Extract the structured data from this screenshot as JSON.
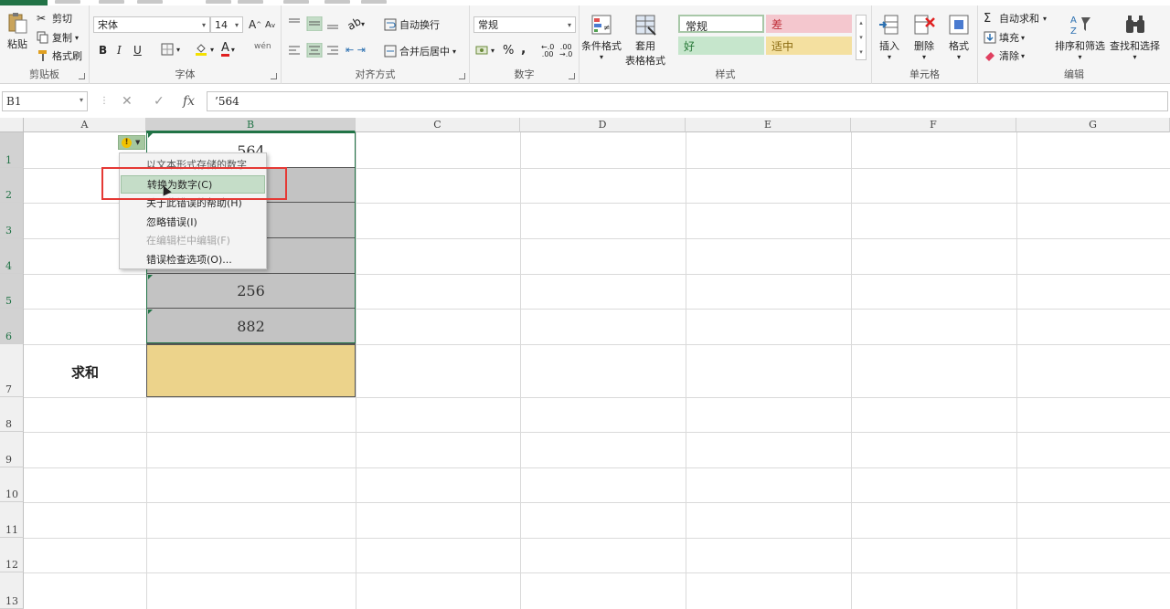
{
  "ribbon": {
    "clipboard": {
      "label": "剪贴板",
      "paste": "粘贴",
      "cut": "剪切",
      "copy": "复制",
      "format_painter": "格式刷"
    },
    "font": {
      "label": "字体",
      "name": "宋体",
      "size": "14",
      "bold": "B",
      "italic": "I",
      "underline": "U"
    },
    "alignment": {
      "label": "对齐方式",
      "wrap_text": "自动换行",
      "merge_center": "合并后居中"
    },
    "number": {
      "label": "数字",
      "format": "常规",
      "percent": "%",
      "comma": ","
    },
    "styles": {
      "label": "样式",
      "conditional_format": "条件格式",
      "table_format_line1": "套用",
      "table_format_line2": "表格格式",
      "normal": "常规",
      "bad": "差",
      "good": "好",
      "neutral": "适中",
      "colors": {
        "normal": "#ffffff",
        "bad": "#f4c7ce",
        "good": "#c6e6cc",
        "neutral": "#f4e0a0"
      }
    },
    "cells": {
      "label": "单元格",
      "insert": "插入",
      "delete": "删除",
      "format": "格式"
    },
    "editing": {
      "label": "编辑",
      "autosum": "自动求和",
      "fill": "填充",
      "clear": "清除",
      "sort_filter": "排序和筛选",
      "find_select": "查找和选择"
    }
  },
  "formula_bar": {
    "name_box": "B1",
    "cancel": "✕",
    "enter": "✓",
    "fx": "fx",
    "content": "’564"
  },
  "sheet": {
    "columns": [
      "A",
      "B",
      "C",
      "D",
      "E",
      "F",
      "G"
    ],
    "rows": [
      "1",
      "2",
      "3",
      "4",
      "5",
      "6",
      "7",
      "8",
      "9",
      "10",
      "11",
      "12",
      "13"
    ],
    "cells": {
      "B1": "564",
      "B5": "256",
      "B6": "882",
      "A7": "求和"
    }
  },
  "error_menu": {
    "title": "以文本形式存储的数字",
    "items": [
      {
        "label": "转换为数字(C)",
        "state": "hover"
      },
      {
        "label": "关于此错误的帮助(H)",
        "state": "normal"
      },
      {
        "label": "忽略错误(I)",
        "state": "normal"
      },
      {
        "label": "在编辑栏中编辑(F)",
        "state": "disabled"
      },
      {
        "label": "错误检查选项(O)...",
        "state": "normal"
      }
    ]
  },
  "accent_color": "#217346",
  "highlight_color": "#e53935"
}
